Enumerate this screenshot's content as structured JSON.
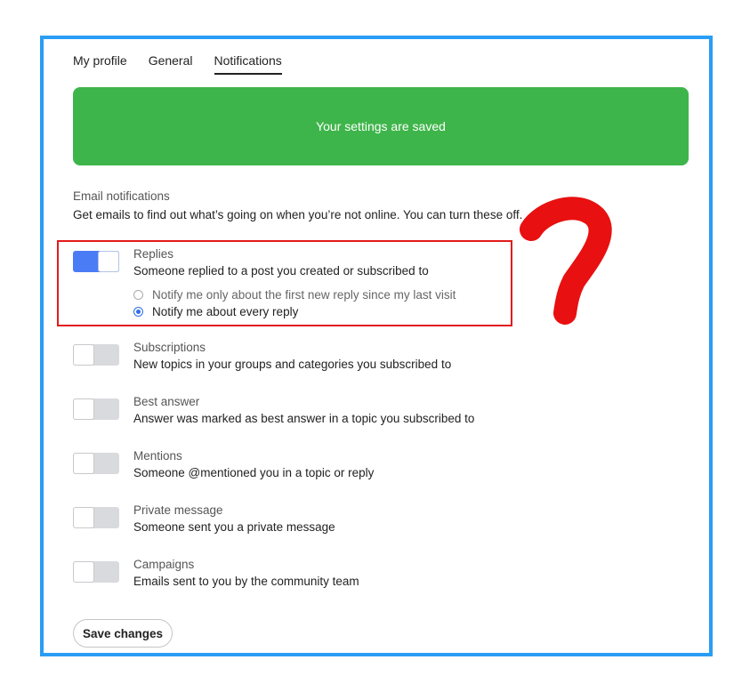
{
  "tabs": [
    {
      "label": "My profile",
      "active": false
    },
    {
      "label": "General",
      "active": false
    },
    {
      "label": "Notifications",
      "active": true
    }
  ],
  "banner": {
    "text": "Your settings are saved",
    "color": "#3eb54a"
  },
  "email_section": {
    "title": "Email notifications",
    "description": "Get emails to find out what’s going on when you’re not online. You can turn these off."
  },
  "notifications": [
    {
      "label": "Replies",
      "description": "Someone replied to a post you created or subscribed to",
      "enabled": true,
      "options": [
        {
          "label": "Notify me only about the first new reply since my last visit",
          "selected": false
        },
        {
          "label": "Notify me about every reply",
          "selected": true
        }
      ]
    },
    {
      "label": "Subscriptions",
      "description": "New topics in your groups and categories you subscribed to",
      "enabled": false
    },
    {
      "label": "Best answer",
      "description": "Answer was marked as best answer in a topic you subscribed to",
      "enabled": false
    },
    {
      "label": "Mentions",
      "description": "Someone @mentioned you in a topic or reply",
      "enabled": false
    },
    {
      "label": "Private message",
      "description": "Someone sent you a private message",
      "enabled": false
    },
    {
      "label": "Campaigns",
      "description": "Emails sent to you by the community team",
      "enabled": false
    }
  ],
  "save_button": {
    "label": "Save changes"
  },
  "annotations": {
    "highlight_color": "#e21b1b",
    "question_mark_color": "#e81010"
  },
  "colors": {
    "accent": "#2a9df4",
    "toggle_on": "#4a7cf5",
    "toggle_off": "#d9dadd"
  }
}
